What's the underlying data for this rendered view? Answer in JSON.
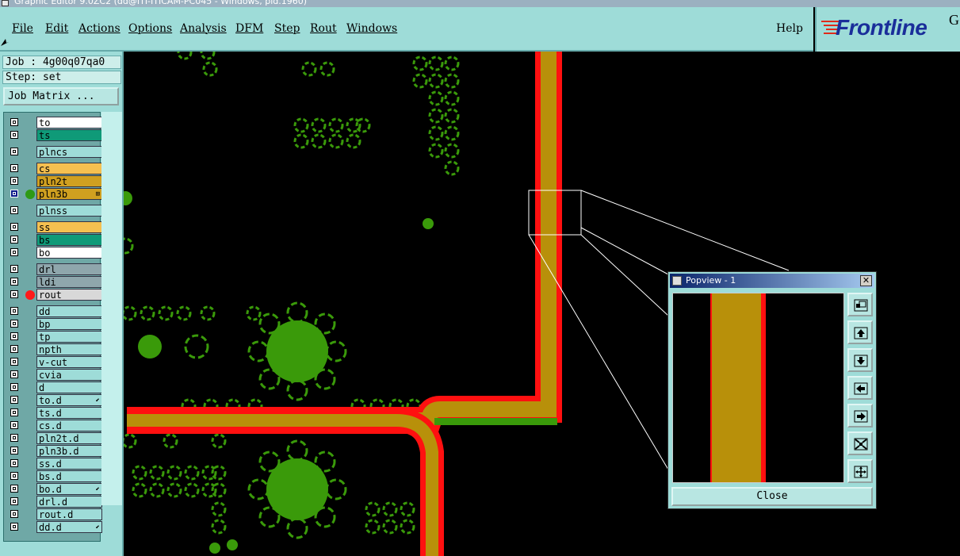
{
  "titlebar": {
    "title": "Graphic Editor 9.0ZC2 (dd@ITI-ITICAM-PC045 - Windows, pid.1960)"
  },
  "menu": {
    "items": [
      "File",
      "Edit",
      "Actions",
      "Options",
      "Analysis",
      "DFM",
      "Step",
      "Rout",
      "Windows"
    ],
    "help": "Help"
  },
  "logo": {
    "text": "Frontline",
    "suffix": "G"
  },
  "job": {
    "job_line": "Job : 4g00q07qa0",
    "step_line": "Step: set",
    "matrix_button": "Job Matrix ..."
  },
  "layers": [
    {
      "name": "to",
      "color": "#ffffff",
      "group": 1
    },
    {
      "name": "ts",
      "color": "#0f9a78",
      "group": 1
    },
    {
      "name": "plncs",
      "color": "#9edcd8",
      "group": 2
    },
    {
      "name": "cs",
      "color": "#f5c050",
      "group": 3
    },
    {
      "name": "pln2t",
      "color": "#d0a020",
      "group": 3
    },
    {
      "name": "pln3b",
      "color": "#d0a020",
      "group": 3,
      "active": true,
      "dot": "#2e9a16",
      "marker": "⊞"
    },
    {
      "name": "plnss",
      "color": "#9edcd8",
      "group": 4
    },
    {
      "name": "ss",
      "color": "#f5c050",
      "group": 5
    },
    {
      "name": "bs",
      "color": "#0f9a78",
      "group": 5
    },
    {
      "name": "bo",
      "color": "#ffffff",
      "group": 5
    },
    {
      "name": "drl",
      "color": "#8fa6ac",
      "group": 6
    },
    {
      "name": "ldi",
      "color": "#8fa6ac",
      "group": 6
    },
    {
      "name": "rout",
      "color": "#d8d8d8",
      "group": 6,
      "dot": "#ff1a1a"
    },
    {
      "name": "dd",
      "color": "#9edcd8",
      "group": 7
    },
    {
      "name": "bp",
      "color": "#9edcd8",
      "group": 7
    },
    {
      "name": "tp",
      "color": "#9edcd8",
      "group": 7
    },
    {
      "name": "npth",
      "color": "#9edcd8",
      "group": 7
    },
    {
      "name": "v-cut",
      "color": "#9edcd8",
      "group": 7
    },
    {
      "name": "cvia",
      "color": "#9edcd8",
      "group": 7
    },
    {
      "name": "d",
      "color": "#9edcd8",
      "group": 7
    },
    {
      "name": "to.d",
      "color": "#9edcd8",
      "group": 7,
      "marker": "⬋"
    },
    {
      "name": "ts.d",
      "color": "#9edcd8",
      "group": 7
    },
    {
      "name": "cs.d",
      "color": "#9edcd8",
      "group": 7
    },
    {
      "name": "pln2t.d",
      "color": "#9edcd8",
      "group": 7
    },
    {
      "name": "pln3b.d",
      "color": "#9edcd8",
      "group": 7
    },
    {
      "name": "ss.d",
      "color": "#9edcd8",
      "group": 7
    },
    {
      "name": "bs.d",
      "color": "#9edcd8",
      "group": 7
    },
    {
      "name": "bo.d",
      "color": "#9edcd8",
      "group": 7,
      "marker": "⬋"
    },
    {
      "name": "drl.d",
      "color": "#9edcd8",
      "group": 7
    },
    {
      "name": "rout.d",
      "color": "#9edcd8",
      "group": 7
    },
    {
      "name": "dd.d",
      "color": "#9edcd8",
      "group": 7,
      "marker": "⬋"
    }
  ],
  "colors": {
    "pad_green": "#3a9a0a",
    "trace_gold": "#b8900a",
    "trace_red": "#ff1010",
    "ui_cyan": "#9edcd8"
  },
  "popview": {
    "title": "Popview - 1",
    "close_x": "✕",
    "close_button": "Close",
    "tools": [
      "zoom-fit-icon",
      "pan-up-icon",
      "pan-down-icon",
      "pan-left-icon",
      "pan-right-icon",
      "zoom-in-icon",
      "zoom-out-icon"
    ]
  }
}
